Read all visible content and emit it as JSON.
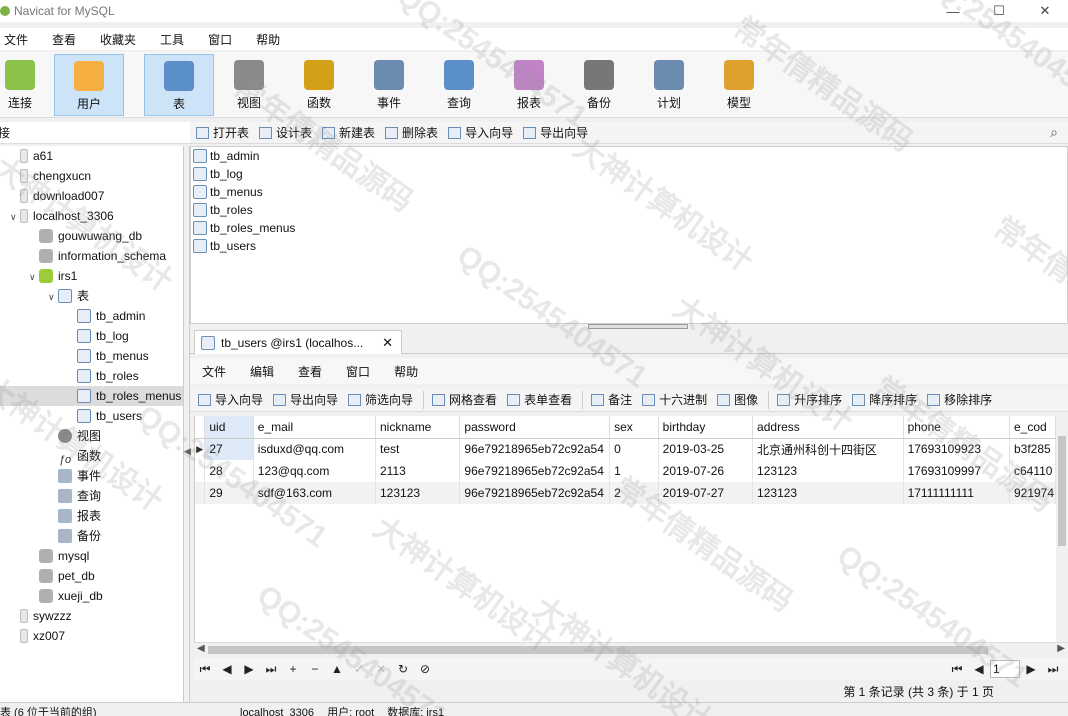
{
  "window": {
    "title": "Navicat for MySQL",
    "min": "—",
    "max": "☐",
    "close": "✕"
  },
  "menubar": [
    "文件",
    "查看",
    "收藏夹",
    "工具",
    "窗口",
    "帮助"
  ],
  "toolbar": [
    {
      "label": "连接",
      "icon": "connection-icon",
      "color": "#8bc34a"
    },
    {
      "label": "用户",
      "icon": "user-icon",
      "color": "#f5b041"
    },
    {
      "label": "表",
      "icon": "table-icon",
      "color": "#5b8fc9"
    },
    {
      "label": "视图",
      "icon": "view-icon",
      "color": "#8a8a8a"
    },
    {
      "label": "函数",
      "icon": "function-icon",
      "color": "#d4a017"
    },
    {
      "label": "事件",
      "icon": "event-icon",
      "color": "#6b8bb0"
    },
    {
      "label": "查询",
      "icon": "query-icon",
      "color": "#5b8fc9"
    },
    {
      "label": "报表",
      "icon": "report-icon",
      "color": "#c084c6"
    },
    {
      "label": "备份",
      "icon": "backup-icon",
      "color": "#777777"
    },
    {
      "label": "计划",
      "icon": "schedule-icon",
      "color": "#6b8bb0"
    },
    {
      "label": "模型",
      "icon": "model-icon",
      "color": "#e0a030"
    }
  ],
  "left_panel": {
    "header": "连接",
    "tree": [
      {
        "label": "a61",
        "type": "conn",
        "indent": 0,
        "twisty": ""
      },
      {
        "label": "chengxucn",
        "type": "conn",
        "indent": 0,
        "twisty": ""
      },
      {
        "label": "download007",
        "type": "conn",
        "indent": 0,
        "twisty": ""
      },
      {
        "label": "localhost_3306",
        "type": "conn-on",
        "indent": 0,
        "twisty": "∨"
      },
      {
        "label": "gouwuwang_db",
        "type": "db",
        "indent": 1,
        "twisty": ""
      },
      {
        "label": "information_schema",
        "type": "db",
        "indent": 1,
        "twisty": ""
      },
      {
        "label": "irs1",
        "type": "db-on",
        "indent": 1,
        "twisty": "∨"
      },
      {
        "label": "表",
        "type": "table",
        "indent": 2,
        "twisty": "∨"
      },
      {
        "label": "tb_admin",
        "type": "table",
        "indent": 3,
        "twisty": ""
      },
      {
        "label": "tb_log",
        "type": "table",
        "indent": 3,
        "twisty": ""
      },
      {
        "label": "tb_menus",
        "type": "table",
        "indent": 3,
        "twisty": ""
      },
      {
        "label": "tb_roles",
        "type": "table",
        "indent": 3,
        "twisty": ""
      },
      {
        "label": "tb_roles_menus",
        "type": "table",
        "indent": 3,
        "twisty": "",
        "selected": true
      },
      {
        "label": "tb_users",
        "type": "table",
        "indent": 3,
        "twisty": ""
      },
      {
        "label": "视图",
        "type": "view",
        "indent": 2,
        "twisty": ""
      },
      {
        "label": "函数",
        "type": "func",
        "indent": 2,
        "twisty": ""
      },
      {
        "label": "事件",
        "type": "gen",
        "indent": 2,
        "twisty": ""
      },
      {
        "label": "查询",
        "type": "gen",
        "indent": 2,
        "twisty": ""
      },
      {
        "label": "报表",
        "type": "gen",
        "indent": 2,
        "twisty": ""
      },
      {
        "label": "备份",
        "type": "gen",
        "indent": 2,
        "twisty": ""
      },
      {
        "label": "mysql",
        "type": "db",
        "indent": 1,
        "twisty": ""
      },
      {
        "label": "pet_db",
        "type": "db",
        "indent": 1,
        "twisty": ""
      },
      {
        "label": "xueji_db",
        "type": "db",
        "indent": 1,
        "twisty": ""
      },
      {
        "label": "sywzzz",
        "type": "conn",
        "indent": 0,
        "twisty": ""
      },
      {
        "label": "xz007",
        "type": "conn",
        "indent": 0,
        "twisty": ""
      }
    ]
  },
  "object_toolbar": [
    "打开表",
    "设计表",
    "新建表",
    "删除表",
    "导入向导",
    "导出向导"
  ],
  "object_list": [
    "tb_admin",
    "tb_log",
    "tb_menus",
    "tb_roles",
    "tb_roles_menus",
    "tb_users"
  ],
  "tab": {
    "label": "tb_users @irs1 (localhos...",
    "close": "✕"
  },
  "inner_menu": [
    "文件",
    "编辑",
    "查看",
    "窗口",
    "帮助"
  ],
  "data_toolbar": [
    "导入向导",
    "导出向导",
    "筛选向导",
    "|",
    "网格查看",
    "表单查看",
    "|",
    "备注",
    "十六进制",
    "图像",
    "|",
    "升序排序",
    "降序排序",
    "移除排序"
  ],
  "grid": {
    "columns": [
      {
        "name": "uid",
        "w": 50
      },
      {
        "name": "e_mail",
        "w": 124
      },
      {
        "name": "nickname",
        "w": 86
      },
      {
        "name": "password",
        "w": 150
      },
      {
        "name": "sex",
        "w": 50
      },
      {
        "name": "birthday",
        "w": 96
      },
      {
        "name": "address",
        "w": 152
      },
      {
        "name": "phone",
        "w": 108
      },
      {
        "name": "e_cod",
        "w": 46
      }
    ],
    "rows": [
      [
        "27",
        "isduxd@qq.com",
        "test",
        "96e79218965eb72c92a54",
        "0",
        "2019-03-25",
        "北京通州科创十四街区",
        "17693109923",
        "b3f285"
      ],
      [
        "28",
        "123@qq.com",
        "2113",
        "96e79218965eb72c92a54",
        "1",
        "2019-07-26",
        "123123",
        "17693109997",
        "c64110"
      ],
      [
        "29",
        "sdf@163.com",
        "123123",
        "96e79218965eb72c92a54",
        "2",
        "2019-07-27",
        "123123",
        "17111111111",
        "921974"
      ]
    ]
  },
  "navigator": [
    "⏮",
    "◀",
    "▶",
    "⏭",
    "+",
    "−",
    "▲",
    "✓",
    "✕",
    "↻",
    "⊘"
  ],
  "page": {
    "current": "1"
  },
  "record_status": "第 1 条记录 (共 3 条) 于 1 页",
  "statusbar": {
    "left": "表 (6 位于当前的组)",
    "connection": "localhost_3306",
    "user": "用户: root",
    "database": "数据库: irs1"
  },
  "watermarks": [
    "QQ:2545404571",
    "大神计算机设计",
    "常年倩精品源码"
  ]
}
